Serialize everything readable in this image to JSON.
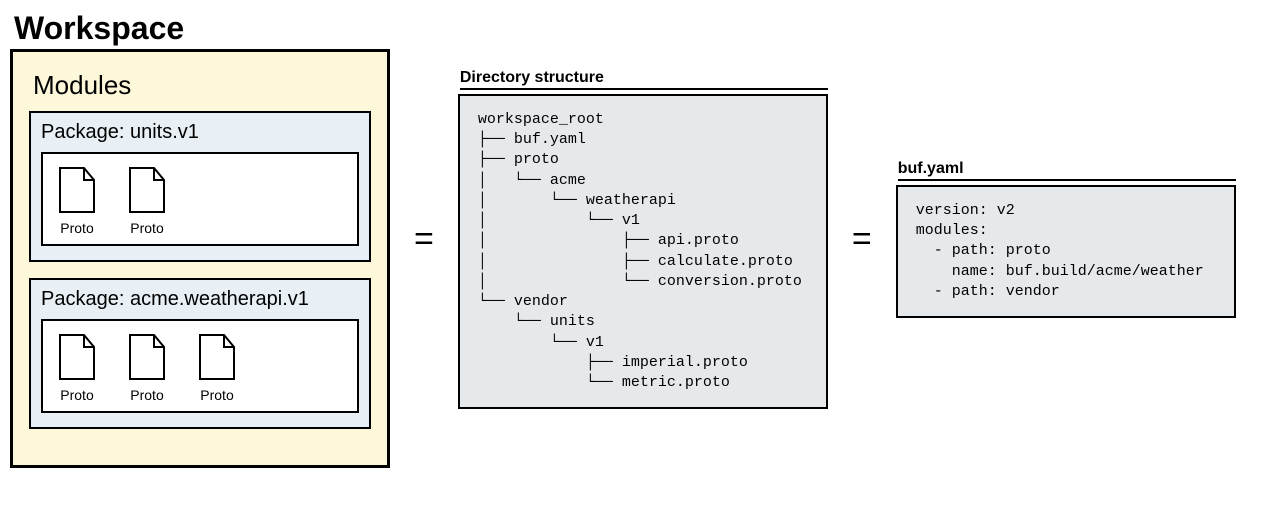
{
  "workspace": {
    "title": "Workspace",
    "modules_title": "Modules",
    "packages": [
      {
        "label": "Package: units.v1",
        "files": [
          "Proto",
          "Proto"
        ]
      },
      {
        "label": "Package: acme.weatherapi.v1",
        "files": [
          "Proto",
          "Proto",
          "Proto"
        ]
      }
    ]
  },
  "equals": "=",
  "directory": {
    "title": "Directory structure",
    "tree": "workspace_root\n├── buf.yaml\n├── proto\n│   └── acme\n│       └── weatherapi\n│           └── v1\n│               ├── api.proto\n│               ├── calculate.proto\n│               └── conversion.proto\n└── vendor\n    └── units\n        └── v1\n            ├── imperial.proto\n            └── metric.proto"
  },
  "buf_yaml": {
    "title": "buf.yaml",
    "content": "version: v2\nmodules:\n  - path: proto\n    name: buf.build/acme/weather\n  - path: vendor"
  }
}
